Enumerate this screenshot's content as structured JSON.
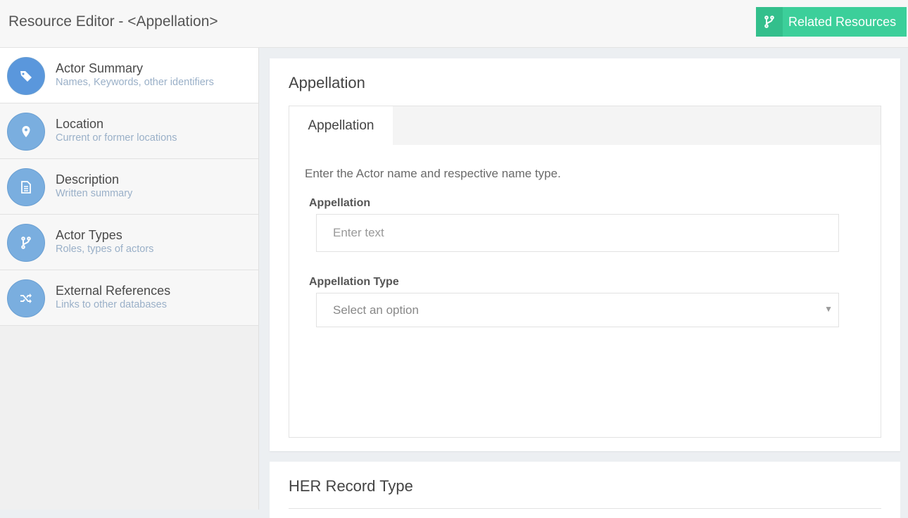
{
  "header": {
    "title": "Resource Editor - <Appellation>",
    "related_button": {
      "label": "Related Resources",
      "icon": "fork-icon"
    }
  },
  "sidebar": {
    "items": [
      {
        "title": "Actor Summary",
        "subtitle": "Names, Keywords, other identifiers",
        "icon": "tag-icon",
        "active": true
      },
      {
        "title": "Location",
        "subtitle": "Current or former locations",
        "icon": "map-pin-icon",
        "active": false
      },
      {
        "title": "Description",
        "subtitle": "Written summary",
        "icon": "document-icon",
        "active": false
      },
      {
        "title": "Actor Types",
        "subtitle": "Roles, types of actors",
        "icon": "fork-icon",
        "active": false
      },
      {
        "title": "External References",
        "subtitle": "Links to other databases",
        "icon": "shuffle-icon",
        "active": false
      }
    ]
  },
  "main": {
    "card_title": "Appellation",
    "tab_label": "Appellation",
    "instructions": "Enter the Actor name and respective name type.",
    "appellation_field": {
      "label": "Appellation",
      "placeholder": "Enter text",
      "value": ""
    },
    "appellation_type_field": {
      "label": "Appellation Type",
      "placeholder": "Select an option"
    },
    "second_card_title": "HER Record Type"
  },
  "colors": {
    "accent_green": "#3ccf9a",
    "sidebar_icon_blue": "#7aaedf",
    "active_icon_blue": "#5a97dc"
  }
}
